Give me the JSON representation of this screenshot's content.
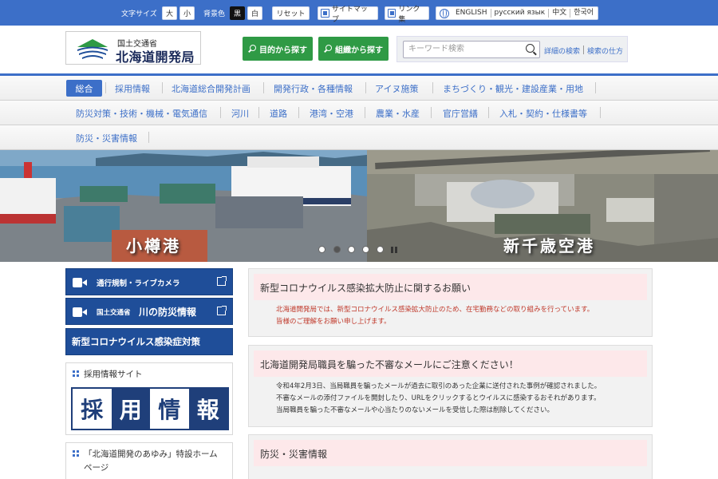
{
  "topbar": {
    "text_size_label": "文字サイズ",
    "size_large": "大",
    "size_small": "小",
    "bgcolor_label": "背景色",
    "bg_black": "黒",
    "bg_white": "白",
    "reset": "リセット",
    "sitemap": "サイトマップ",
    "links": "リンク集",
    "languages": [
      "ENGLISH",
      "русский язык",
      "中文",
      "한국어"
    ]
  },
  "header": {
    "logo_small": "国土交通省",
    "logo_big": "北海道開発局",
    "purpose_search": "目的から探す",
    "org_search": "組織から探す",
    "search_placeholder": "キーワード検索",
    "advanced_search": "詳細の検索",
    "search_help": "検索の仕方"
  },
  "nav": {
    "row1": [
      "総合",
      "採用情報",
      "北海道総合開発計画",
      "開発行政・各種情報",
      "アイヌ施策",
      "まちづくり・観光・建設産業・用地"
    ],
    "row2": [
      "防災対策・技術・機械・電気通信",
      "河川",
      "道路",
      "港湾・空港",
      "農業・水産",
      "官庁営繕",
      "入札・契約・仕様書等"
    ],
    "row3": [
      "防災・災害情報"
    ]
  },
  "banner": {
    "left_caption": "小樽港",
    "right_caption": "新千歳空港",
    "slide_count": 5,
    "active_slide": 2
  },
  "sidebar": {
    "traffic_camera": "通行規制・ライブカメラ",
    "river_prefix": "国土交通省",
    "river_main": "川の防災情報",
    "covid": "新型コロナウイルス感染症対策",
    "recruit_site": "採用情報サイト",
    "recruit_chars": [
      "採",
      "用",
      "情",
      "報"
    ],
    "history_line1": "「北海道開発のあゆみ」特設ホーム",
    "history_line2": "ページ"
  },
  "main": {
    "notice1_title": "新型コロナウイルス感染拡大防止に関するお願い",
    "notice1_line1": "北海道開発局では、新型コロナウイルス感染拡大防止のため、在宅勤務などの取り組みを行っています。",
    "notice1_line2": "皆様のご理解をお願い申し上げます。",
    "notice2_title": "北海道開発局職員を騙った不審なメールにご注意ください！",
    "notice2_line1": "令和4年2月3日、当局職員を騙ったメールが過去に取引のあった企業に送付された事例が確認されました。",
    "notice2_line2": "不審なメールの添付ファイルを開封したり、URLをクリックするとウイルスに感染するおそれがあります。",
    "notice2_line3": "当局職員を騙った不審なメールや心当たりのないメールを受信した際は削除してください。",
    "disaster_title": "防災・災害情報"
  },
  "colors": {
    "brand_blue": "#3c6fc8",
    "dark_blue": "#1f4e99",
    "green": "#2f9a45",
    "notice_red": "#c0392b"
  }
}
